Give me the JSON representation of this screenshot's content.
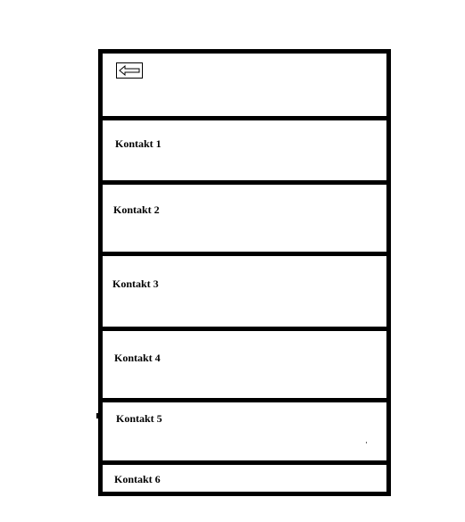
{
  "app": {
    "back_icon": "back-arrow-icon"
  },
  "contacts": [
    {
      "label": "Kontakt 1"
    },
    {
      "label": "Kontakt 2"
    },
    {
      "label": "Kontakt 3"
    },
    {
      "label": "Kontakt 4"
    },
    {
      "label": "Kontakt 5"
    },
    {
      "label": "Kontakt 6"
    }
  ],
  "colors": {
    "border": "#000000",
    "background": "#ffffff",
    "text": "#000000"
  }
}
